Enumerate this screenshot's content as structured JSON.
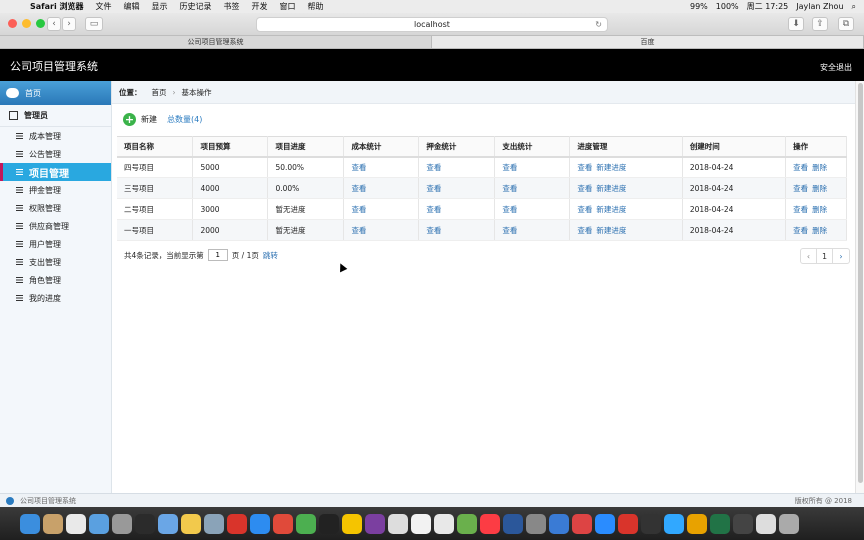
{
  "menubar": {
    "app": "Safari 浏览器",
    "items": [
      "文件",
      "编辑",
      "显示",
      "历史记录",
      "书签",
      "开发",
      "窗口",
      "帮助"
    ],
    "battery": "99%",
    "battery2": "100%",
    "datetime": "周二 17:25",
    "user": "Jaylan Zhou"
  },
  "browser": {
    "url": "localhost",
    "tabs": [
      "公司项目管理系统",
      "百度"
    ]
  },
  "header": {
    "title": "公司项目管理系统",
    "logout": "安全退出"
  },
  "sidebar": {
    "home": "首页",
    "admin": "管理员",
    "items": [
      "成本管理",
      "公告管理",
      "项目管理",
      "押金管理",
      "权限管理",
      "供应商管理",
      "用户管理",
      "支出管理",
      "角色管理",
      "我的进度"
    ],
    "active_index": 2
  },
  "breadcrumb": {
    "label": "位置：",
    "home": "首页",
    "separator": "›",
    "current": "基本操作"
  },
  "toolbar": {
    "new_label": "新建",
    "count_label": "总数量(4)"
  },
  "table": {
    "headers": [
      "项目名称",
      "项目预算",
      "项目进度",
      "成本统计",
      "押金统计",
      "支出统计",
      "进度管理",
      "创建时间",
      "操作"
    ],
    "rows": [
      {
        "name": "四号项目",
        "budget": "5000",
        "progress": "50.00%",
        "cost": "查看",
        "deposit": "查看",
        "expense": "查看",
        "view": "查看",
        "new_progress": "新建进度",
        "created": "2018-04-24",
        "op_view": "查看",
        "op_delete": "删除"
      },
      {
        "name": "三号项目",
        "budget": "4000",
        "progress": "0.00%",
        "cost": "查看",
        "deposit": "查看",
        "expense": "查看",
        "view": "查看",
        "new_progress": "新建进度",
        "created": "2018-04-24",
        "op_view": "查看",
        "op_delete": "删除"
      },
      {
        "name": "二号项目",
        "budget": "3000",
        "progress": "暂无进度",
        "cost": "查看",
        "deposit": "查看",
        "expense": "查看",
        "view": "查看",
        "new_progress": "新建进度",
        "created": "2018-04-24",
        "op_view": "查看",
        "op_delete": "删除"
      },
      {
        "name": "一号项目",
        "budget": "2000",
        "progress": "暂无进度",
        "cost": "查看",
        "deposit": "查看",
        "expense": "查看",
        "view": "查看",
        "new_progress": "新建进度",
        "created": "2018-04-24",
        "op_view": "查看",
        "op_delete": "删除"
      }
    ]
  },
  "pager": {
    "summary": "共4条记录，当前显示第",
    "page": "1",
    "of": "页 / 1页",
    "jump": "跳转",
    "prev": "‹",
    "current": "1",
    "next": "›"
  },
  "footer": {
    "left": "公司项目管理系统",
    "right": "版权所有 @ 2018"
  },
  "colors": {
    "accent": "#29a8e0",
    "header_bg": "#000000",
    "link": "#2a6fb0",
    "add_green": "#3bb34a"
  }
}
